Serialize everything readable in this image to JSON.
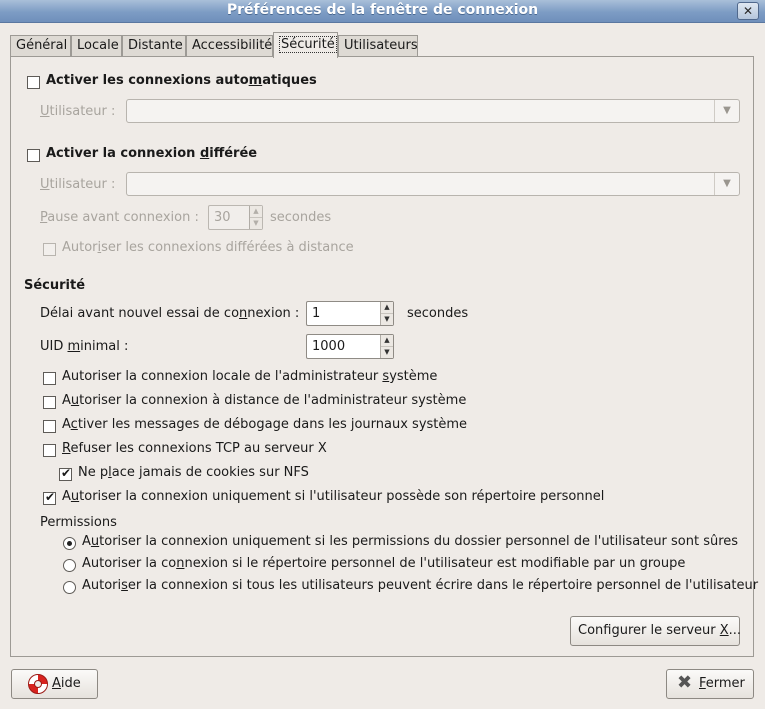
{
  "window": {
    "title": "Préférences de la fenêtre de connexion",
    "close_glyph": "✕"
  },
  "tabs": [
    "Général",
    "Locale",
    "Distante",
    "Accessibilité",
    "Sécurité",
    "Utilisateurs"
  ],
  "auto_login": {
    "label_pre": "Activer les connexions auto",
    "label_key": "m",
    "label_post": "atiques",
    "user_label_key": "U",
    "user_label_rest": "tilisateur :"
  },
  "timed_login": {
    "label_pre": "Activer la connexion ",
    "label_key": "d",
    "label_post": "ifférée",
    "user_label_key": "U",
    "user_label_rest": "tilisateur :",
    "pause_label_key": "P",
    "pause_label_rest": "ause avant connexion :",
    "pause_value": "30",
    "pause_unit": "secondes",
    "remote_pre": "Autor",
    "remote_key": "i",
    "remote_post": "ser les connexions différées à distance"
  },
  "security": {
    "heading": "Sécurité",
    "retry_pre": "Délai avant nouvel essai de co",
    "retry_key": "n",
    "retry_post": "nexion :",
    "retry_value": "1",
    "retry_unit": "secondes",
    "uid_pre": "UID ",
    "uid_key": "m",
    "uid_post": "inimal :",
    "uid_value": "1000",
    "options": [
      {
        "pre": "Autoriser la connexion locale de l'administrateur ",
        "key": "s",
        "post": "ystème",
        "checked": false
      },
      {
        "pre": "A",
        "key": "u",
        "post": "toriser la connexion à distance de l'administrateur système",
        "checked": false
      },
      {
        "pre": "A",
        "key": "c",
        "post": "tiver les messages de débogage dans les journaux système",
        "checked": false
      },
      {
        "pre": "",
        "key": "R",
        "post": "efuser les connexions TCP au serveur X",
        "checked": false
      },
      {
        "pre": "Ne p",
        "key": "l",
        "post": "ace jamais de cookies sur NFS",
        "checked": true
      },
      {
        "pre": "A",
        "key": "u",
        "post": "toriser la connexion uniquement si l'utilisateur possède son répertoire personnel",
        "checked": true
      }
    ],
    "check_glyph": "✔",
    "permissions_label": "Permissions",
    "permissions": [
      {
        "pre": "A",
        "key": "u",
        "post": "toriser la connexion uniquement si les permissions du dossier personnel de l'utilisateur sont sûres",
        "selected": true
      },
      {
        "pre": "Autoriser la co",
        "key": "n",
        "post": "nexion si le répertoire personnel de l'utilisateur est modifiable par un groupe",
        "selected": false
      },
      {
        "pre": "Autori",
        "key": "s",
        "post": "er la connexion si tous les utilisateurs peuvent écrire dans le répertoire personnel de l'utilisateur",
        "selected": false
      }
    ],
    "configure_pre": "Configurer le serveur ",
    "configure_key": "X",
    "configure_post": "..."
  },
  "footer": {
    "help_key": "A",
    "help_rest": "ide",
    "close_key": "F",
    "close_rest": "ermer",
    "close_glyph": "✖"
  }
}
